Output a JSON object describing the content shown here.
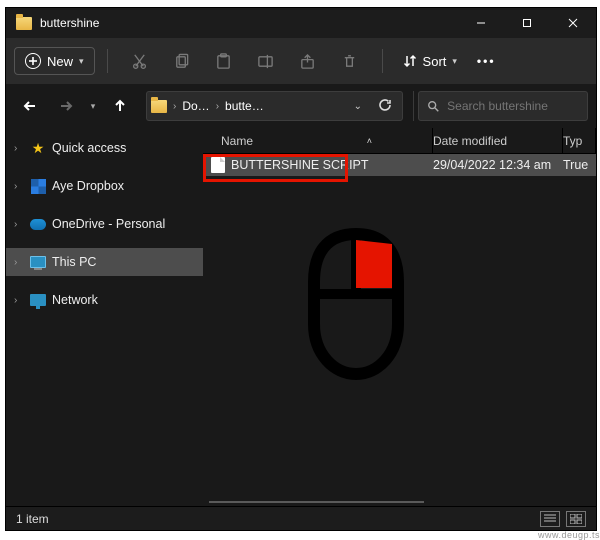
{
  "window": {
    "title": "buttershine"
  },
  "toolbar": {
    "new_label": "New",
    "sort_label": "Sort"
  },
  "address": {
    "crumbs": [
      "Do…",
      "butte…"
    ]
  },
  "search": {
    "placeholder": "Search buttershine"
  },
  "sidebar": {
    "items": [
      {
        "label": "Quick access"
      },
      {
        "label": "Aye Dropbox"
      },
      {
        "label": "OneDrive - Personal"
      },
      {
        "label": "This PC"
      },
      {
        "label": "Network"
      }
    ]
  },
  "columns": {
    "name": "Name",
    "date": "Date modified",
    "type": "Typ"
  },
  "files": [
    {
      "name": "BUTTERSHINE SCRIPT",
      "date": "29/04/2022 12:34 am",
      "type": "True"
    }
  ],
  "status": {
    "count_label": "1 item"
  },
  "annotation": {
    "highlight_color": "#e51400",
    "mouse_button": "right"
  },
  "watermark": "www.deugp.ts"
}
